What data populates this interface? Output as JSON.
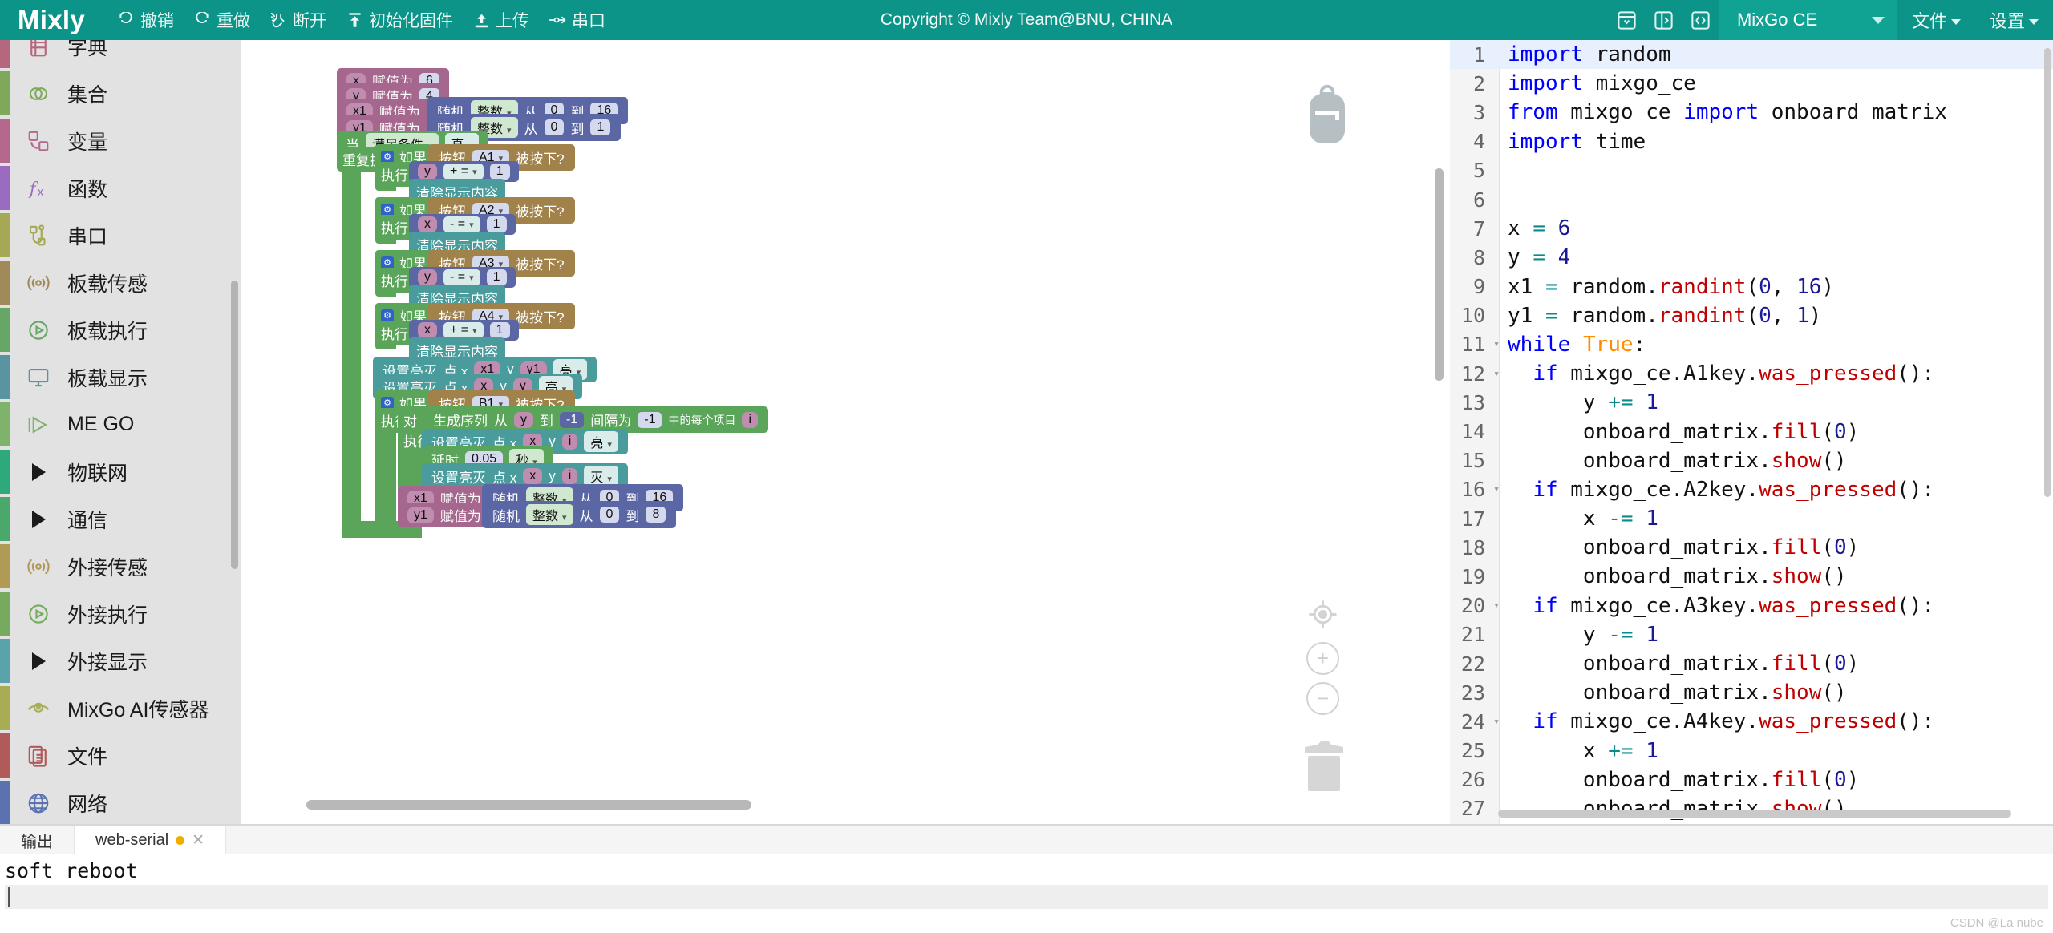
{
  "topbar": {
    "brand": "Mixly",
    "copyright": "Copyright © Mixly Team@BNU, CHINA",
    "accent_color": "#0d9488",
    "buttons": [
      {
        "id": "undo",
        "label": "撤销",
        "icon": "undo-icon"
      },
      {
        "id": "redo",
        "label": "重做",
        "icon": "redo-icon"
      },
      {
        "id": "disconnect",
        "label": "断开",
        "icon": "disconnect-icon"
      },
      {
        "id": "init-firmware",
        "label": "初始化固件",
        "icon": "firmware-icon"
      },
      {
        "id": "upload",
        "label": "上传",
        "icon": "upload-icon"
      },
      {
        "id": "serial",
        "label": "串口",
        "icon": "serial-icon"
      }
    ],
    "right_icons": [
      {
        "id": "save-panel",
        "icon": "save-box-icon"
      },
      {
        "id": "split-panel",
        "icon": "panel-split-icon"
      },
      {
        "id": "code-view",
        "icon": "code-brackets-icon"
      }
    ],
    "board": {
      "label": "MixGo CE"
    },
    "menus": [
      {
        "id": "file",
        "label": "文件"
      },
      {
        "id": "settings",
        "label": "设置"
      }
    ]
  },
  "sidebar": {
    "items": [
      {
        "label": "字典",
        "icon": "dictionary-icon",
        "color": "#b5677e",
        "expandable": false
      },
      {
        "label": "集合",
        "icon": "sets-icon",
        "color": "#7fa85a",
        "expandable": false
      },
      {
        "label": "变量",
        "icon": "variable-icon",
        "color": "#b5678e",
        "expandable": false
      },
      {
        "label": "函数",
        "icon": "function-icon",
        "color": "#9a6bbf",
        "expandable": false
      },
      {
        "label": "串口",
        "icon": "serial-port-icon",
        "color": "#a5a855",
        "expandable": false
      },
      {
        "label": "板载传感",
        "icon": "sensor-icon",
        "color": "#a08a5a",
        "expandable": false
      },
      {
        "label": "板载执行",
        "icon": "actuator-icon",
        "color": "#66a766",
        "expandable": false
      },
      {
        "label": "板载显示",
        "icon": "display-icon",
        "color": "#5a94a0",
        "expandable": false
      },
      {
        "label": "ME GO",
        "icon": "mego-icon",
        "color": "#7fb36b",
        "expandable": false
      },
      {
        "label": "物联网",
        "icon": "triangle-icon",
        "color": "#2ea97c",
        "expandable": true
      },
      {
        "label": "通信",
        "icon": "triangle-icon",
        "color": "#4aa86a",
        "expandable": true
      },
      {
        "label": "外接传感",
        "icon": "sensor-icon",
        "color": "#b09a55",
        "expandable": false
      },
      {
        "label": "外接执行",
        "icon": "actuator-icon",
        "color": "#76aa5e",
        "expandable": false
      },
      {
        "label": "外接显示",
        "icon": "triangle-icon",
        "color": "#5aa3ab",
        "expandable": true
      },
      {
        "label": "MixGo AI传感器",
        "icon": "ai-eye-icon",
        "color": "#a8ad55",
        "expandable": false
      },
      {
        "label": "文件",
        "icon": "file-icon",
        "color": "#b05a5a",
        "expandable": false
      },
      {
        "label": "网络",
        "icon": "globe-icon",
        "color": "#5a72b0",
        "expandable": false
      }
    ]
  },
  "workspace": {
    "controls": {
      "backpack": "backpack-icon",
      "center": "center-target-icon",
      "zoom_in": "zoom-in-icon",
      "zoom_out": "zoom-out-icon",
      "trash": "trash-icon"
    },
    "words": {
      "assign": "赋值为",
      "random": "随机",
      "integer": "整数",
      "from": "从",
      "to": "到",
      "when": "当",
      "condition": "满足条件",
      "true": "真",
      "repeat": "重复执行",
      "if": "如果",
      "do": "执行",
      "button": "按钮",
      "pressed": "被按下?",
      "clear_display": "清除显示内容",
      "set_led": "设置亮灭",
      "point_x": "点 x",
      "y": "y",
      "on": "亮",
      "off": "灭",
      "foreach": "对",
      "seq": "生成序列",
      "step": "间隔为",
      "each_item": "中的每个项目",
      "delay": "延时",
      "second": "秒",
      "plus_eq": "+ =",
      "minus_eq": "- ="
    },
    "values": {
      "x_init": "6",
      "y_init": "4",
      "x1_rand_from": "0",
      "x1_rand_to": "16",
      "y1_rand_from": "0",
      "y1_rand_to": "1",
      "btn_a1": "A1",
      "btn_a2": "A2",
      "btn_a3": "A3",
      "btn_a4": "A4",
      "btn_b1": "B1",
      "one": "1",
      "seq_to": "-1",
      "seq_step": "-1",
      "delay_val": "0.05",
      "x1_rand2_from": "0",
      "x1_rand2_to": "16",
      "y1_rand2_from": "0",
      "y1_rand2_to": "8",
      "i": "i",
      "var_x": "x",
      "var_y": "y",
      "var_x1": "x1",
      "var_y1": "y1"
    }
  },
  "code": {
    "active_line": 1,
    "lines": [
      {
        "n": 1,
        "fold": "",
        "tokens": [
          {
            "t": "import",
            "c": "kw"
          },
          {
            "t": " random",
            "c": ""
          }
        ]
      },
      {
        "n": 2,
        "fold": "",
        "tokens": [
          {
            "t": "import",
            "c": "kw"
          },
          {
            "t": " mixgo_ce",
            "c": ""
          }
        ]
      },
      {
        "n": 3,
        "fold": "",
        "tokens": [
          {
            "t": "from",
            "c": "kw"
          },
          {
            "t": " mixgo_ce ",
            "c": ""
          },
          {
            "t": "import",
            "c": "kw"
          },
          {
            "t": " onboard_matrix",
            "c": ""
          }
        ]
      },
      {
        "n": 4,
        "fold": "",
        "tokens": [
          {
            "t": "import",
            "c": "kw"
          },
          {
            "t": " time",
            "c": ""
          }
        ]
      },
      {
        "n": 5,
        "fold": "",
        "tokens": [
          {
            "t": "",
            "c": ""
          }
        ]
      },
      {
        "n": 6,
        "fold": "",
        "tokens": [
          {
            "t": "",
            "c": ""
          }
        ]
      },
      {
        "n": 7,
        "fold": "",
        "tokens": [
          {
            "t": "x ",
            "c": ""
          },
          {
            "t": "=",
            "c": "op"
          },
          {
            "t": " ",
            "c": ""
          },
          {
            "t": "6",
            "c": "num"
          }
        ]
      },
      {
        "n": 8,
        "fold": "",
        "tokens": [
          {
            "t": "y ",
            "c": ""
          },
          {
            "t": "=",
            "c": "op"
          },
          {
            "t": " ",
            "c": ""
          },
          {
            "t": "4",
            "c": "num"
          }
        ]
      },
      {
        "n": 9,
        "fold": "",
        "tokens": [
          {
            "t": "x1 ",
            "c": ""
          },
          {
            "t": "=",
            "c": "op"
          },
          {
            "t": " random.",
            "c": ""
          },
          {
            "t": "randint",
            "c": "fn"
          },
          {
            "t": "(",
            "c": ""
          },
          {
            "t": "0",
            "c": "num"
          },
          {
            "t": ", ",
            "c": ""
          },
          {
            "t": "16",
            "c": "num"
          },
          {
            "t": ")",
            "c": ""
          }
        ]
      },
      {
        "n": 10,
        "fold": "",
        "tokens": [
          {
            "t": "y1 ",
            "c": ""
          },
          {
            "t": "=",
            "c": "op"
          },
          {
            "t": " random.",
            "c": ""
          },
          {
            "t": "randint",
            "c": "fn"
          },
          {
            "t": "(",
            "c": ""
          },
          {
            "t": "0",
            "c": "num"
          },
          {
            "t": ", ",
            "c": ""
          },
          {
            "t": "1",
            "c": "num"
          },
          {
            "t": ")",
            "c": ""
          }
        ]
      },
      {
        "n": 11,
        "fold": "▾",
        "tokens": [
          {
            "t": "while",
            "c": "kw"
          },
          {
            "t": " ",
            "c": ""
          },
          {
            "t": "True",
            "c": "bi"
          },
          {
            "t": ":",
            "c": ""
          }
        ]
      },
      {
        "n": 12,
        "fold": "▾",
        "tokens": [
          {
            "t": "  ",
            "c": ""
          },
          {
            "t": "if",
            "c": "kw"
          },
          {
            "t": " mixgo_ce.A1key.",
            "c": ""
          },
          {
            "t": "was_pressed",
            "c": "fn"
          },
          {
            "t": "():",
            "c": ""
          }
        ]
      },
      {
        "n": 13,
        "fold": "",
        "tokens": [
          {
            "t": "      y ",
            "c": ""
          },
          {
            "t": "+=",
            "c": "op"
          },
          {
            "t": " ",
            "c": ""
          },
          {
            "t": "1",
            "c": "num"
          }
        ]
      },
      {
        "n": 14,
        "fold": "",
        "tokens": [
          {
            "t": "      onboard_matrix.",
            "c": ""
          },
          {
            "t": "fill",
            "c": "fn"
          },
          {
            "t": "(",
            "c": ""
          },
          {
            "t": "0",
            "c": "num"
          },
          {
            "t": ")",
            "c": ""
          }
        ]
      },
      {
        "n": 15,
        "fold": "",
        "tokens": [
          {
            "t": "      onboard_matrix.",
            "c": ""
          },
          {
            "t": "show",
            "c": "fn"
          },
          {
            "t": "()",
            "c": ""
          }
        ]
      },
      {
        "n": 16,
        "fold": "▾",
        "tokens": [
          {
            "t": "  ",
            "c": ""
          },
          {
            "t": "if",
            "c": "kw"
          },
          {
            "t": " mixgo_ce.A2key.",
            "c": ""
          },
          {
            "t": "was_pressed",
            "c": "fn"
          },
          {
            "t": "():",
            "c": ""
          }
        ]
      },
      {
        "n": 17,
        "fold": "",
        "tokens": [
          {
            "t": "      x ",
            "c": ""
          },
          {
            "t": "-=",
            "c": "op"
          },
          {
            "t": " ",
            "c": ""
          },
          {
            "t": "1",
            "c": "num"
          }
        ]
      },
      {
        "n": 18,
        "fold": "",
        "tokens": [
          {
            "t": "      onboard_matrix.",
            "c": ""
          },
          {
            "t": "fill",
            "c": "fn"
          },
          {
            "t": "(",
            "c": ""
          },
          {
            "t": "0",
            "c": "num"
          },
          {
            "t": ")",
            "c": ""
          }
        ]
      },
      {
        "n": 19,
        "fold": "",
        "tokens": [
          {
            "t": "      onboard_matrix.",
            "c": ""
          },
          {
            "t": "show",
            "c": "fn"
          },
          {
            "t": "()",
            "c": ""
          }
        ]
      },
      {
        "n": 20,
        "fold": "▾",
        "tokens": [
          {
            "t": "  ",
            "c": ""
          },
          {
            "t": "if",
            "c": "kw"
          },
          {
            "t": " mixgo_ce.A3key.",
            "c": ""
          },
          {
            "t": "was_pressed",
            "c": "fn"
          },
          {
            "t": "():",
            "c": ""
          }
        ]
      },
      {
        "n": 21,
        "fold": "",
        "tokens": [
          {
            "t": "      y ",
            "c": ""
          },
          {
            "t": "-=",
            "c": "op"
          },
          {
            "t": " ",
            "c": ""
          },
          {
            "t": "1",
            "c": "num"
          }
        ]
      },
      {
        "n": 22,
        "fold": "",
        "tokens": [
          {
            "t": "      onboard_matrix.",
            "c": ""
          },
          {
            "t": "fill",
            "c": "fn"
          },
          {
            "t": "(",
            "c": ""
          },
          {
            "t": "0",
            "c": "num"
          },
          {
            "t": ")",
            "c": ""
          }
        ]
      },
      {
        "n": 23,
        "fold": "",
        "tokens": [
          {
            "t": "      onboard_matrix.",
            "c": ""
          },
          {
            "t": "show",
            "c": "fn"
          },
          {
            "t": "()",
            "c": ""
          }
        ]
      },
      {
        "n": 24,
        "fold": "▾",
        "tokens": [
          {
            "t": "  ",
            "c": ""
          },
          {
            "t": "if",
            "c": "kw"
          },
          {
            "t": " mixgo_ce.A4key.",
            "c": ""
          },
          {
            "t": "was_pressed",
            "c": "fn"
          },
          {
            "t": "():",
            "c": ""
          }
        ]
      },
      {
        "n": 25,
        "fold": "",
        "tokens": [
          {
            "t": "      x ",
            "c": ""
          },
          {
            "t": "+=",
            "c": "op"
          },
          {
            "t": " ",
            "c": ""
          },
          {
            "t": "1",
            "c": "num"
          }
        ]
      },
      {
        "n": 26,
        "fold": "",
        "tokens": [
          {
            "t": "      onboard_matrix.",
            "c": ""
          },
          {
            "t": "fill",
            "c": "fn"
          },
          {
            "t": "(",
            "c": ""
          },
          {
            "t": "0",
            "c": "num"
          },
          {
            "t": ")",
            "c": ""
          }
        ]
      },
      {
        "n": 27,
        "fold": "",
        "tokens": [
          {
            "t": "      onboard_matrix.",
            "c": ""
          },
          {
            "t": "show",
            "c": "fn"
          },
          {
            "t": "()",
            "c": ""
          }
        ]
      }
    ]
  },
  "output": {
    "tabs": [
      {
        "id": "output",
        "label": "输出",
        "selected": false,
        "has_dot": false,
        "closable": false
      },
      {
        "id": "web-serial",
        "label": "web-serial",
        "selected": true,
        "has_dot": true,
        "closable": true
      }
    ],
    "console_text": "soft reboot",
    "watermark": "CSDN @La nube"
  }
}
